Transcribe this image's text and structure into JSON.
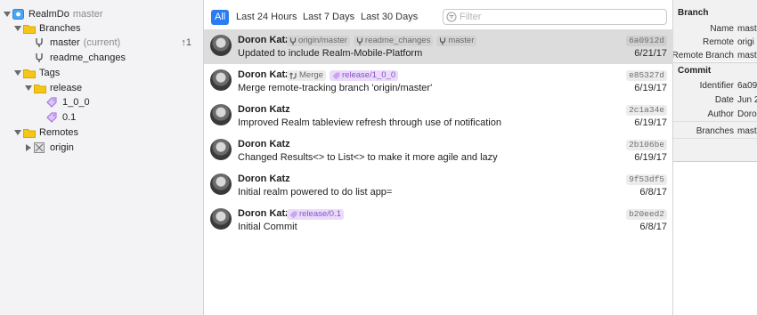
{
  "navigator": {
    "repo": {
      "name": "RealmDo",
      "branch": "master"
    },
    "branches_label": "Branches",
    "branches": [
      {
        "name": "master",
        "note": "(current)",
        "ahead": "↑1"
      },
      {
        "name": "readme_changes"
      }
    ],
    "tags_label": "Tags",
    "tag_folder": "release",
    "tags": [
      "1_0_0",
      "0.1"
    ],
    "remotes_label": "Remotes",
    "remotes": [
      "origin"
    ]
  },
  "filterbar": {
    "segments": [
      "All",
      "Last 24 Hours",
      "Last 7 Days",
      "Last 30 Days"
    ],
    "active": "All",
    "filter_placeholder": "Filter"
  },
  "commits": [
    {
      "author": "Doron Katz",
      "message": "Updated to include Realm-Mobile-Platform",
      "hash": "6a0912d",
      "date": "6/21/17",
      "selected": true,
      "tags": [
        {
          "kind": "branch",
          "label": "origin/master"
        },
        {
          "kind": "branch",
          "label": "readme_changes"
        },
        {
          "kind": "branch",
          "label": "master"
        }
      ]
    },
    {
      "author": "Doron Katz",
      "message": "Merge remote-tracking branch 'origin/master'",
      "hash": "e85327d",
      "date": "6/19/17",
      "tags": [
        {
          "kind": "merge",
          "label": "Merge"
        },
        {
          "kind": "release",
          "label": "release/1_0_0"
        }
      ]
    },
    {
      "author": "Doron Katz",
      "message": "Improved Realm tableview refresh through use of notification",
      "hash": "2c1a34e",
      "date": "6/19/17",
      "tags": []
    },
    {
      "author": "Doron Katz",
      "message": "Changed Results<> to List<> to make it more agile and lazy",
      "hash": "2b106be",
      "date": "6/19/17",
      "tags": []
    },
    {
      "author": "Doron Katz",
      "message": "Initial realm powered to do list app=",
      "hash": "9f53df5",
      "date": "6/8/17",
      "tags": []
    },
    {
      "author": "Doron Katz",
      "message": "Initial Commit",
      "hash": "b20eed2",
      "date": "6/8/17",
      "tags": [
        {
          "kind": "release",
          "label": "release/0.1"
        }
      ]
    }
  ],
  "inspector": {
    "branch_header": "Branch",
    "branch_fields": [
      {
        "key": "Name",
        "value": "mast"
      },
      {
        "key": "Remote",
        "value": "origi"
      },
      {
        "key": "Remote Branch",
        "value": "mast"
      }
    ],
    "commit_header": "Commit",
    "commit_fields": [
      {
        "key": "Identifier",
        "value": "6a09"
      },
      {
        "key": "Date",
        "value": "Jun 2"
      },
      {
        "key": "Author",
        "value": "Doro"
      }
    ],
    "branches_field": {
      "key": "Branches",
      "value": "mast"
    }
  },
  "colors": {
    "accent": "#2a7cf3",
    "folder": "#f5c518",
    "release_tag": "#8b4fd3",
    "selection": "#dcdcdc"
  }
}
